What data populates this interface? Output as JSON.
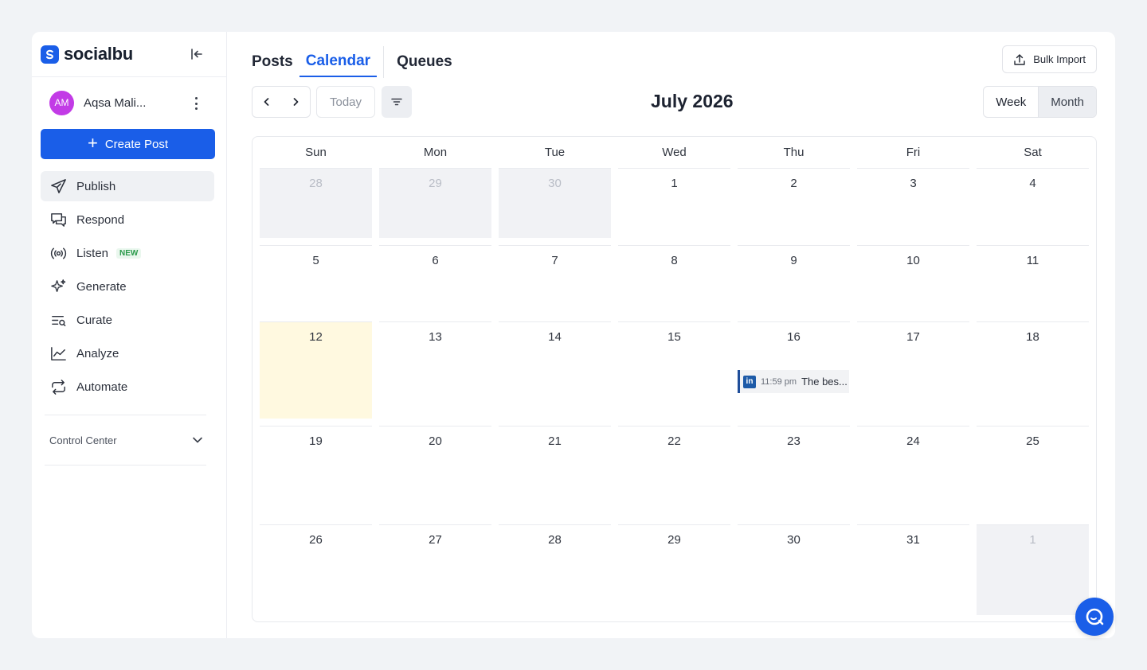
{
  "brand": {
    "name": "socialbu",
    "color": "#1a5ee8"
  },
  "user": {
    "initials": "AM",
    "name": "Aqsa Mali..."
  },
  "sidebar": {
    "create_label": "Create Post",
    "items": [
      {
        "label": "Publish",
        "icon": "send-icon"
      },
      {
        "label": "Respond",
        "icon": "chat-icon"
      },
      {
        "label": "Listen",
        "icon": "broadcast-icon",
        "badge": "NEW"
      },
      {
        "label": "Generate",
        "icon": "sparkle-icon"
      },
      {
        "label": "Curate",
        "icon": "list-search-icon"
      },
      {
        "label": "Analyze",
        "icon": "chart-line-icon"
      },
      {
        "label": "Automate",
        "icon": "repeat-icon"
      }
    ],
    "control_center": "Control Center"
  },
  "tabs": [
    "Posts",
    "Calendar",
    "Queues"
  ],
  "bulk_import": "Bulk Import",
  "toolbar": {
    "today": "Today",
    "month_title": "July 2026",
    "views": [
      "Week",
      "Month"
    ]
  },
  "calendar": {
    "weekdays": [
      "Sun",
      "Mon",
      "Tue",
      "Wed",
      "Thu",
      "Fri",
      "Sat"
    ],
    "weeks": [
      [
        {
          "d": "28",
          "out": true
        },
        {
          "d": "29",
          "out": true
        },
        {
          "d": "30",
          "out": true
        },
        {
          "d": "1"
        },
        {
          "d": "2"
        },
        {
          "d": "3"
        },
        {
          "d": "4"
        }
      ],
      [
        {
          "d": "5"
        },
        {
          "d": "6"
        },
        {
          "d": "7"
        },
        {
          "d": "8"
        },
        {
          "d": "9"
        },
        {
          "d": "10"
        },
        {
          "d": "11"
        }
      ],
      [
        {
          "d": "12",
          "today": true
        },
        {
          "d": "13"
        },
        {
          "d": "14"
        },
        {
          "d": "15"
        },
        {
          "d": "16",
          "event": {
            "time": "11:59 pm",
            "title": "The bes..."
          }
        },
        {
          "d": "17"
        },
        {
          "d": "18"
        }
      ],
      [
        {
          "d": "19"
        },
        {
          "d": "20"
        },
        {
          "d": "21"
        },
        {
          "d": "22"
        },
        {
          "d": "23"
        },
        {
          "d": "24"
        },
        {
          "d": "25"
        }
      ],
      [
        {
          "d": "26"
        },
        {
          "d": "27"
        },
        {
          "d": "28"
        },
        {
          "d": "29"
        },
        {
          "d": "30"
        },
        {
          "d": "31"
        },
        {
          "d": "1",
          "out": true
        }
      ]
    ]
  }
}
